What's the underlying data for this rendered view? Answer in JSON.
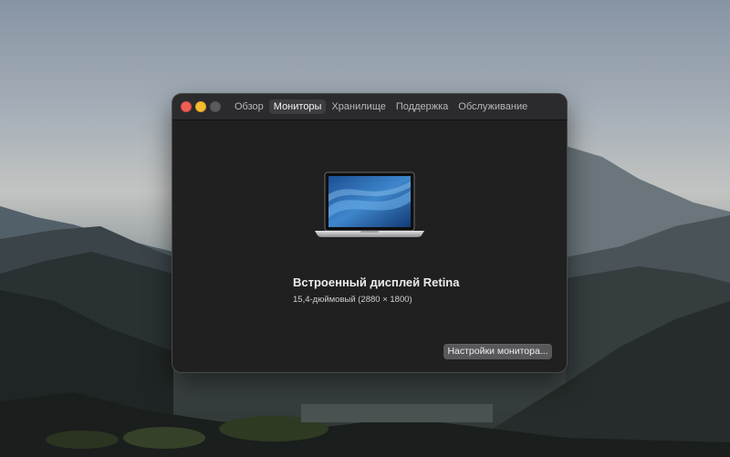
{
  "window": {
    "tabs": [
      {
        "label": "Обзор",
        "active": false
      },
      {
        "label": "Мониторы",
        "active": true
      },
      {
        "label": "Хранилище",
        "active": false
      },
      {
        "label": "Поддержка",
        "active": false
      },
      {
        "label": "Обслуживание",
        "active": false
      }
    ]
  },
  "display": {
    "name": "Встроенный дисплей Retina",
    "spec": "15,4-дюймовый (2880 × 1800)",
    "image_icon": "macbook-pro-icon"
  },
  "actions": {
    "settings_label": "Настройки монитора..."
  },
  "colors": {
    "close": "#ee5f58",
    "minimize": "#f5bd2f",
    "zoom_inactive": "#5a5a5c",
    "window_bg": "#202021",
    "button_bg": "#58585b"
  }
}
